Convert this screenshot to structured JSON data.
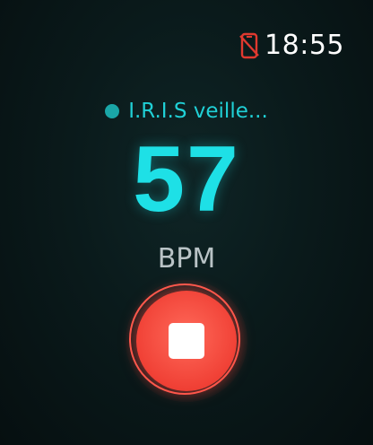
{
  "status_bar": {
    "time": "18:55",
    "connection_icon": "phone-disconnected-icon",
    "connection_icon_color": "#e0392f"
  },
  "assistant": {
    "status_text": "I.R.I.S veille...",
    "dot_color": "#1aa6a7"
  },
  "heart_rate": {
    "value": "57",
    "unit": "BPM",
    "color": "#1ee0e6"
  },
  "controls": {
    "stop_icon": "stop-icon",
    "accent_color": "#f04035"
  }
}
